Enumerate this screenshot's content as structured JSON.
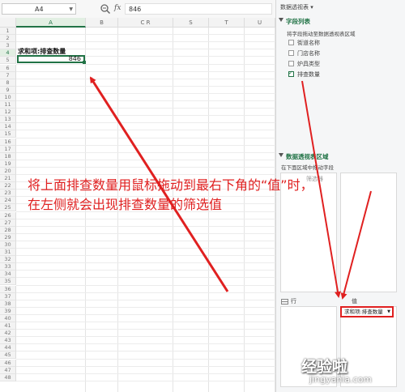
{
  "formula_bar": {
    "name_box": "A4",
    "fx_label": "fx",
    "value": "846"
  },
  "sheet": {
    "columns": [
      "A",
      "B",
      "C R",
      "S",
      "T",
      "U"
    ],
    "rows": [
      "1",
      "2",
      "3",
      "4",
      "5",
      "6",
      "7",
      "8",
      "9",
      "10",
      "11",
      "12",
      "13",
      "14",
      "15",
      "16",
      "17",
      "18",
      "19",
      "20",
      "21",
      "22",
      "23",
      "24",
      "25",
      "26",
      "27",
      "28",
      "29",
      "30",
      "31",
      "32",
      "33",
      "34",
      "35",
      "36",
      "37",
      "38",
      "39",
      "40",
      "41",
      "42",
      "43",
      "44",
      "45",
      "46",
      "47",
      "48"
    ],
    "cells": {
      "a3": "求和项:排查数量",
      "a4": "846"
    }
  },
  "panel": {
    "title": "数据透视表 ▾",
    "field_list_header": "字段列表",
    "drag_hint": "将字段拖动至数据透视表区域",
    "fields": [
      {
        "label": "街道名称",
        "checked": false
      },
      {
        "label": "门店名称",
        "checked": false
      },
      {
        "label": "炉具类型",
        "checked": false
      },
      {
        "label": "排查数量",
        "checked": true
      }
    ],
    "areas_header": "数据透视表区域",
    "areas_hint": "在下面区域中拖动字段",
    "filter_label": "筛选器",
    "rows_label": "行",
    "values_label": "值",
    "value_field": "求和项:排查数量"
  },
  "annotation": {
    "line1": "将上面排查数量用鼠标拖动到最右下角的“值”时，",
    "line2": "在左侧就会出现排查数量的筛选值"
  },
  "watermark": {
    "main": "经验啦",
    "sub": "jingyanla.com"
  },
  "colors": {
    "accent": "#217346",
    "annotation": "#e02020"
  }
}
